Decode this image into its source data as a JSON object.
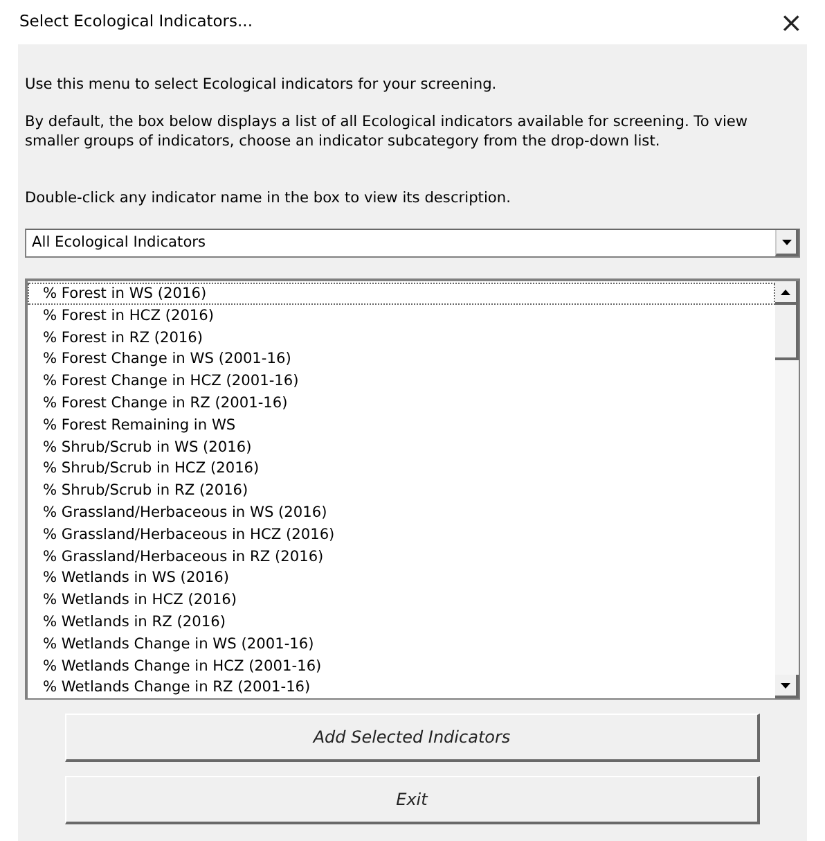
{
  "window": {
    "title": "Select Ecological Indicators...",
    "close": "×"
  },
  "intro": [
    "Use this menu to select Ecological indicators for your screening.",
    "By default, the box below displays a list of all Ecological indicators available for screening. To view smaller groups of indicators, choose an indicator subcategory from the drop-down list.",
    "Double-click any indicator name in the box to view its description."
  ],
  "dropdown": {
    "value": "All Ecological Indicators"
  },
  "indicators": [
    {
      "label": "% Forest in WS (2016)",
      "focused": true
    },
    {
      "label": "% Forest in HCZ (2016)",
      "focused": false
    },
    {
      "label": "% Forest in RZ (2016)",
      "focused": false
    },
    {
      "label": "% Forest Change in WS (2001-16)",
      "focused": false
    },
    {
      "label": "% Forest Change in HCZ (2001-16)",
      "focused": false
    },
    {
      "label": "% Forest Change in RZ (2001-16)",
      "focused": false
    },
    {
      "label": "% Forest Remaining in WS",
      "focused": false
    },
    {
      "label": "% Shrub/Scrub in WS (2016)",
      "focused": false
    },
    {
      "label": "% Shrub/Scrub in HCZ (2016)",
      "focused": false
    },
    {
      "label": "% Shrub/Scrub in RZ (2016)",
      "focused": false
    },
    {
      "label": "% Grassland/Herbaceous in WS (2016)",
      "focused": false
    },
    {
      "label": "% Grassland/Herbaceous in HCZ (2016)",
      "focused": false
    },
    {
      "label": "% Grassland/Herbaceous in RZ (2016)",
      "focused": false
    },
    {
      "label": "% Wetlands in WS (2016)",
      "focused": false
    },
    {
      "label": "% Wetlands in HCZ (2016)",
      "focused": false
    },
    {
      "label": "% Wetlands in RZ (2016)",
      "focused": false
    },
    {
      "label": "% Wetlands Change in WS (2001-16)",
      "focused": false
    },
    {
      "label": "% Wetlands Change in HCZ (2001-16)",
      "focused": false
    },
    {
      "label": "% Wetlands Change in RZ (2001-16)",
      "focused": false
    }
  ],
  "buttons": [
    "Add Selected Indicators",
    "Exit"
  ]
}
